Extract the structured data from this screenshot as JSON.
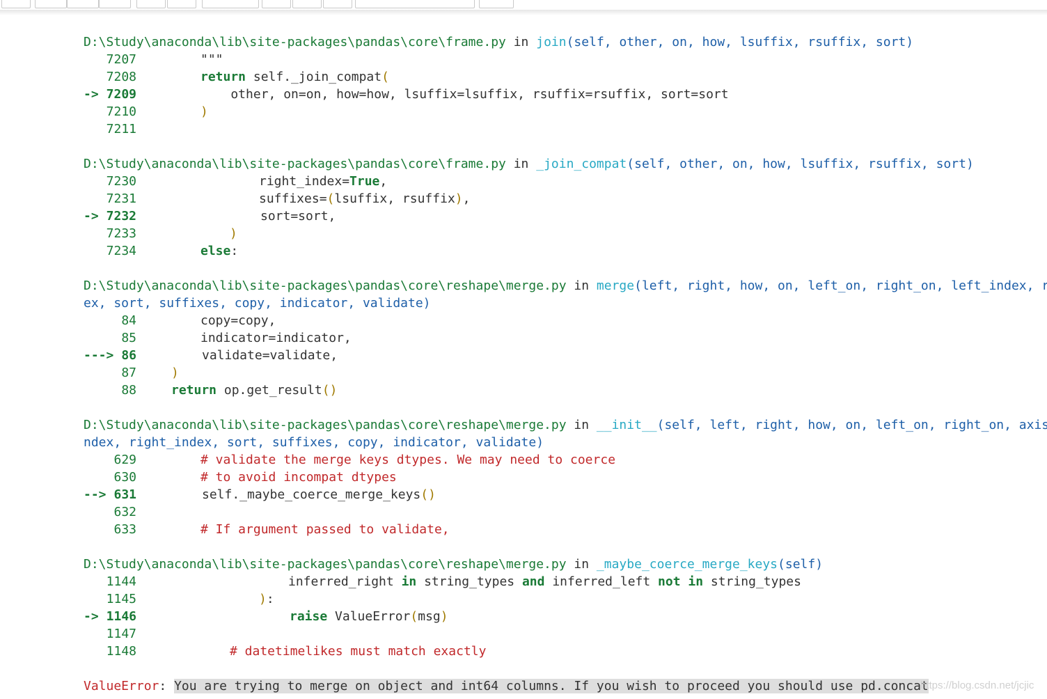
{
  "toolbar": {
    "clipped_text": " .  .   .   .     .  .  . .   .   ...  ..   ."
  },
  "frames": [
    {
      "path": "D:\\Study\\anaconda\\lib\\site-packages\\pandas\\core\\frame.py",
      "in": "in",
      "func": "join",
      "args": "(self, other, on, how, lsuffix, rsuffix, sort)",
      "lines": [
        {
          "arrow": "",
          "num": "7207",
          "code": "\"\"\""
        },
        {
          "arrow": "",
          "num": "7208",
          "code": "return self._join_compat("
        },
        {
          "arrow": "->",
          "num": "7209",
          "code": "    other, on=on, how=how, lsuffix=lsuffix, rsuffix=rsuffix, sort=sort"
        },
        {
          "arrow": "",
          "num": "7210",
          "code": ")"
        },
        {
          "arrow": "",
          "num": "7211",
          "code": ""
        }
      ]
    },
    {
      "path": "D:\\Study\\anaconda\\lib\\site-packages\\pandas\\core\\frame.py",
      "in": "in",
      "func": "_join_compat",
      "args": "(self, other, on, how, lsuffix, rsuffix, sort)",
      "lines": [
        {
          "arrow": "",
          "num": "7230",
          "code": "right_index=True,"
        },
        {
          "arrow": "",
          "num": "7231",
          "code": "suffixes=(lsuffix, rsuffix),"
        },
        {
          "arrow": "->",
          "num": "7232",
          "code": "sort=sort,"
        },
        {
          "arrow": "",
          "num": "7233",
          "code": ")"
        },
        {
          "arrow": "",
          "num": "7234",
          "code": "else:"
        }
      ]
    },
    {
      "path": "D:\\Study\\anaconda\\lib\\site-packages\\pandas\\core\\reshape\\merge.py",
      "in": "in",
      "func": "merge",
      "args": "(left, right, how, on, left_on, right_on, left_index, r",
      "args2": "ex, sort, suffixes, copy, indicator, validate)",
      "lines": [
        {
          "arrow": "",
          "num": "84",
          "code": "copy=copy,"
        },
        {
          "arrow": "",
          "num": "85",
          "code": "indicator=indicator,"
        },
        {
          "arrow": "--->",
          "num": "86",
          "code": "validate=validate,"
        },
        {
          "arrow": "",
          "num": "87",
          "code": ")"
        },
        {
          "arrow": "",
          "num": "88",
          "code": "return op.get_result()"
        }
      ]
    },
    {
      "path": "D:\\Study\\anaconda\\lib\\site-packages\\pandas\\core\\reshape\\merge.py",
      "in": "in",
      "func": "__init__",
      "args": "(self, left, right, how, on, left_on, right_on, axis",
      "args2": "ndex, right_index, sort, suffixes, copy, indicator, validate)",
      "lines": [
        {
          "arrow": "",
          "num": "629",
          "code": "# validate the merge keys dtypes. We may need to coerce"
        },
        {
          "arrow": "",
          "num": "630",
          "code": "# to avoid incompat dtypes"
        },
        {
          "arrow": "-->",
          "num": "631",
          "code": "self._maybe_coerce_merge_keys()"
        },
        {
          "arrow": "",
          "num": "632",
          "code": ""
        },
        {
          "arrow": "",
          "num": "633",
          "code": "# If argument passed to validate,"
        }
      ]
    },
    {
      "path": "D:\\Study\\anaconda\\lib\\site-packages\\pandas\\core\\reshape\\merge.py",
      "in": "in",
      "func": "_maybe_coerce_merge_keys",
      "args": "(self)",
      "lines": [
        {
          "arrow": "",
          "num": "1144",
          "code": "inferred_right in string_types and inferred_left not in string_types"
        },
        {
          "arrow": "",
          "num": "1145",
          "code": "):"
        },
        {
          "arrow": "->",
          "num": "1146",
          "code": "raise ValueError(msg)"
        },
        {
          "arrow": "",
          "num": "1147",
          "code": ""
        },
        {
          "arrow": "",
          "num": "1148",
          "code": "# datetimelikes must match exactly"
        }
      ]
    }
  ],
  "error": {
    "type": "ValueError",
    "sep": ": ",
    "message": "You are trying to merge on object and int64 columns. If you wish to proceed you should use pd.concat"
  },
  "watermark": "https://blog.csdn.net/jcjic"
}
